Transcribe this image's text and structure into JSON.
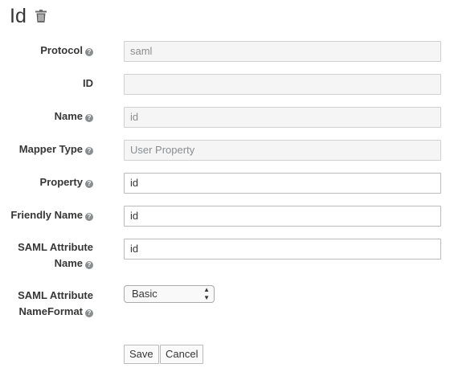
{
  "page": {
    "title": "Id"
  },
  "form": {
    "protocol": {
      "label": "Protocol",
      "value": "saml"
    },
    "id": {
      "label": "ID",
      "value": ""
    },
    "name": {
      "label": "Name",
      "value": "id"
    },
    "mapper_type": {
      "label": "Mapper Type",
      "value": "User Property"
    },
    "property": {
      "label": "Property",
      "value": "id"
    },
    "friendly_name": {
      "label": "Friendly Name",
      "value": "id"
    },
    "saml_attribute_name": {
      "label_line1": "SAML Attribute",
      "label_line2": "Name",
      "value": "id"
    },
    "saml_attribute_nameformat": {
      "label_line1": "SAML Attribute",
      "label_line2": "NameFormat",
      "selected": "Basic"
    }
  },
  "buttons": {
    "save": "Save",
    "cancel": "Cancel"
  },
  "icons": {
    "delete": "trash-icon",
    "help": "question-circle-icon",
    "select_arrows": "updown-arrows-icon"
  },
  "colors": {
    "text": "#363636",
    "readonly_bg": "#f5f5f5",
    "help_icon": "#8b8d8f"
  }
}
